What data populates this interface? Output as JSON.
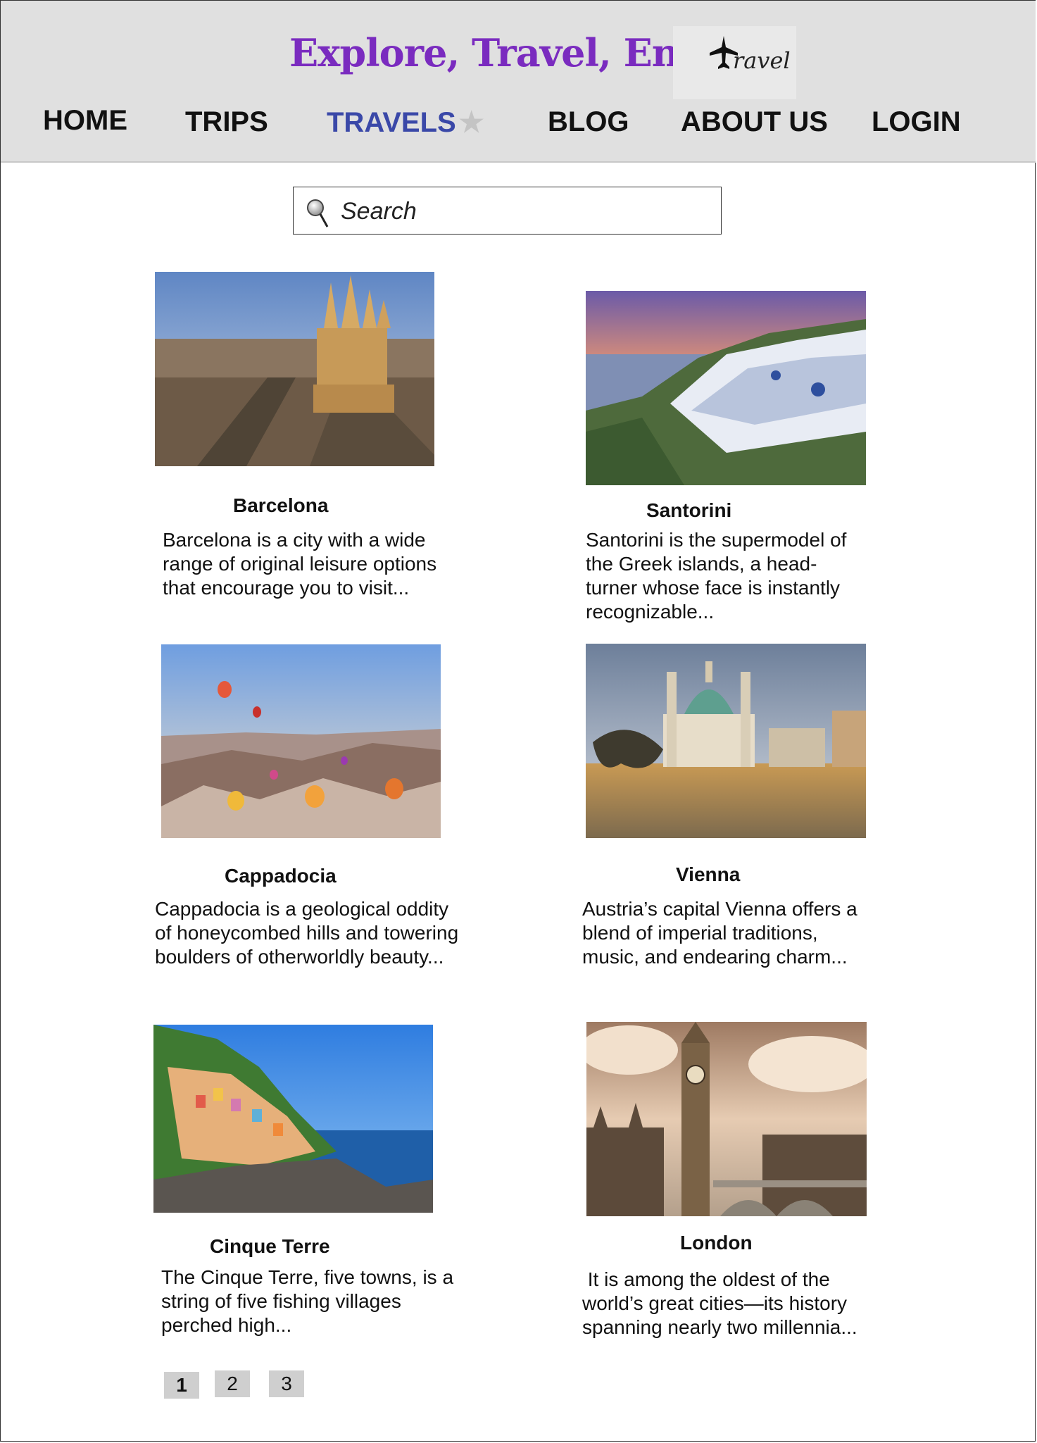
{
  "header": {
    "title": "Explore, Travel, Enjoy",
    "logo_text": "ravel",
    "logo_icon": "airplane-icon"
  },
  "nav": {
    "home": "HOME",
    "trips": "TRIPS",
    "travels": "TRAVELS",
    "blog": "BLOG",
    "about": "ABOUT US",
    "login": "LOGIN",
    "active_star": "★"
  },
  "search": {
    "placeholder": "Search",
    "icon": "search-icon"
  },
  "cards": [
    {
      "title": "Barcelona",
      "desc": "Barcelona is a city with a wide range of original leisure options that encourage you to  visit...",
      "image": "barcelona-photo"
    },
    {
      "title": "Santorini",
      "desc": "Santorini is the supermodel of the Greek islands, a head-turner whose face is instantly recognizable...",
      "image": "santorini-photo"
    },
    {
      "title": "Cappadocia",
      "desc": "Cappadocia is a geological oddity of honeycombed hills and towering boulders of otherworldly beauty...",
      "image": "cappadocia-photo"
    },
    {
      "title": "Vienna",
      "desc": "Austria’s capital Vienna offers a blend of imperial traditions, music, and endearing charm...",
      "image": "vienna-photo"
    },
    {
      "title": "Cinque Terre",
      "desc": "The Cinque Terre, five towns, is a string of five fishing villages perched high...",
      "image": "cinque-terre-photo"
    },
    {
      "title": "London",
      "desc": " It is among the oldest of the world’s great cities—its history spanning nearly two millennia...",
      "image": "london-photo"
    }
  ],
  "pagination": [
    "1",
    "2",
    "3"
  ],
  "colors": {
    "title": "#7a2bbf",
    "active_nav": "#3a48a8",
    "header_bg": "#e0e0e0"
  }
}
